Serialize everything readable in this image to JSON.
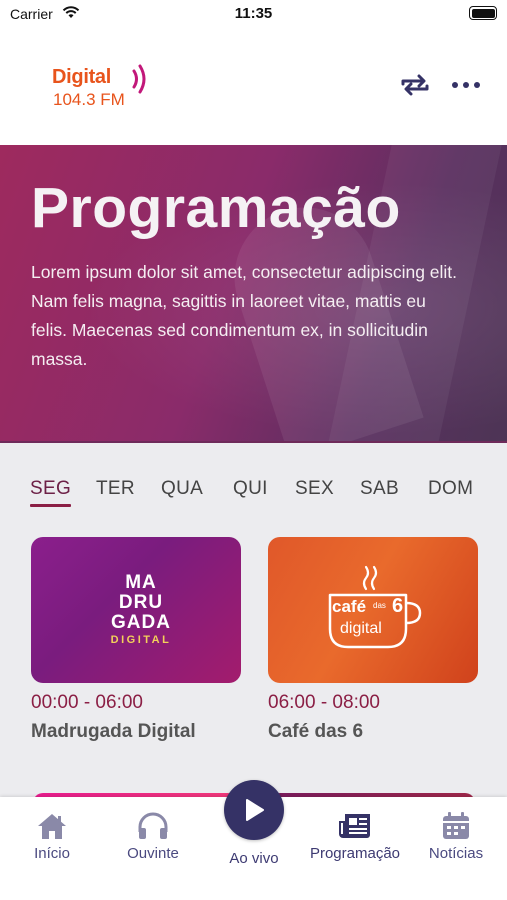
{
  "status_bar": {
    "carrier": "Carrier",
    "time": "11:35"
  },
  "header": {
    "logo_word": "Digital",
    "logo_frequency": "104.3 FM",
    "icons": [
      "repeat-icon",
      "more-icon"
    ]
  },
  "hero": {
    "title": "Programação",
    "description": "Lorem ipsum dolor sit amet, consectetur adipiscing elit. Nam felis magna, sagittis in laoreet vitae, mattis eu felis. Maecenas sed condimentum ex, in sollicitudin massa."
  },
  "day_tabs": {
    "items": [
      "SEG",
      "TER",
      "QUA",
      "QUI",
      "SEX",
      "SAB",
      "DOM"
    ],
    "selected": "SEG"
  },
  "programs": [
    {
      "time": "00:00 - 06:00",
      "title": "Madrugada Digital",
      "logo_lines": [
        "MA",
        "DRU",
        "GADA"
      ],
      "logo_sub": "DIGITAL"
    },
    {
      "time": "06:00 - 08:00",
      "title": "Café das 6",
      "logo_main": "café",
      "logo_das": "das",
      "logo_six": "6",
      "logo_sub": "digital"
    }
  ],
  "bottom_nav": {
    "items": [
      {
        "label": "Início",
        "icon": "home-icon"
      },
      {
        "label": "Ouvinte",
        "icon": "headphones-icon"
      },
      {
        "label": "Ao vivo",
        "icon": "play-icon"
      },
      {
        "label": "Programação",
        "icon": "newspaper-icon"
      },
      {
        "label": "Notícias",
        "icon": "calendar-icon"
      }
    ]
  },
  "colors": {
    "accent": "#8b1f45",
    "nav": "#353266",
    "logo_orange": "#e8541c",
    "logo_magenta": "#c2187a"
  }
}
